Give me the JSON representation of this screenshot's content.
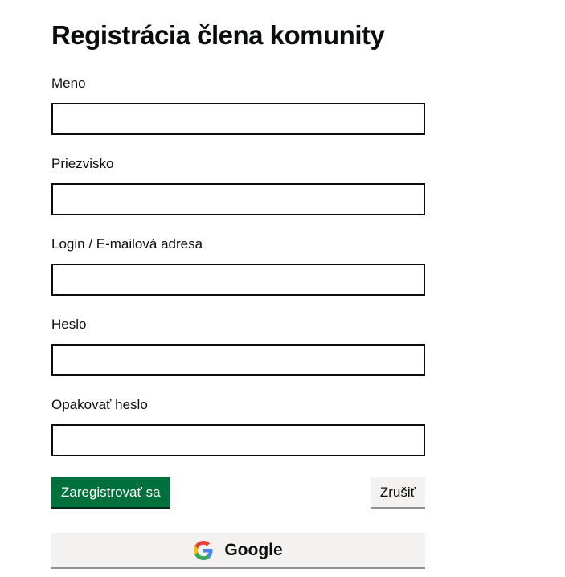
{
  "page": {
    "title": "Registrácia člena komunity"
  },
  "form": {
    "fields": [
      {
        "label": "Meno",
        "value": ""
      },
      {
        "label": "Priezvisko",
        "value": ""
      },
      {
        "label": "Login / E-mailová adresa",
        "value": ""
      },
      {
        "label": "Heslo",
        "value": ""
      },
      {
        "label": "Opakovať heslo",
        "value": ""
      }
    ],
    "submit_label": "Zaregistrovať sa",
    "cancel_label": "Zrušiť",
    "google_label": "Google"
  },
  "colors": {
    "primary_button": "#00703c",
    "secondary_button": "#f3f2f1",
    "text": "#0b0c0c"
  },
  "icons": {
    "google": "google-g-icon"
  }
}
